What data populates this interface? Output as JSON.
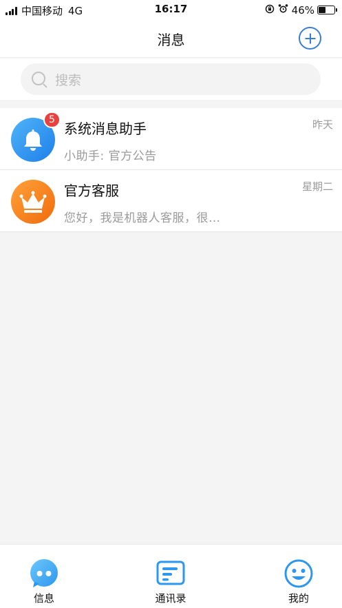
{
  "status_bar": {
    "carrier": "中国移动",
    "network": "4G",
    "time": "16:17",
    "battery": "46%",
    "battery_level": 0.46
  },
  "nav": {
    "title": "消息"
  },
  "search": {
    "placeholder": "搜索"
  },
  "conversations": [
    {
      "name": "系统消息助手",
      "preview": "小助手: 官方公告",
      "time": "昨天",
      "badge": "5",
      "avatar_icon": "bell-icon",
      "avatar_color": "#2a8df0"
    },
    {
      "name": "官方客服",
      "preview": "您好，我是机器人客服，很…",
      "time": "星期二",
      "avatar_icon": "crown-icon",
      "avatar_color": "#f57c18"
    }
  ],
  "tab_bar": {
    "tabs": [
      {
        "label": "信息",
        "icon": "chat-bubble-icon"
      },
      {
        "label": "通讯录",
        "icon": "contacts-card-icon"
      },
      {
        "label": "我的",
        "icon": "smiley-face-icon"
      }
    ]
  },
  "colors": {
    "accent": "#3a7bd5",
    "badge": "#e64240"
  }
}
